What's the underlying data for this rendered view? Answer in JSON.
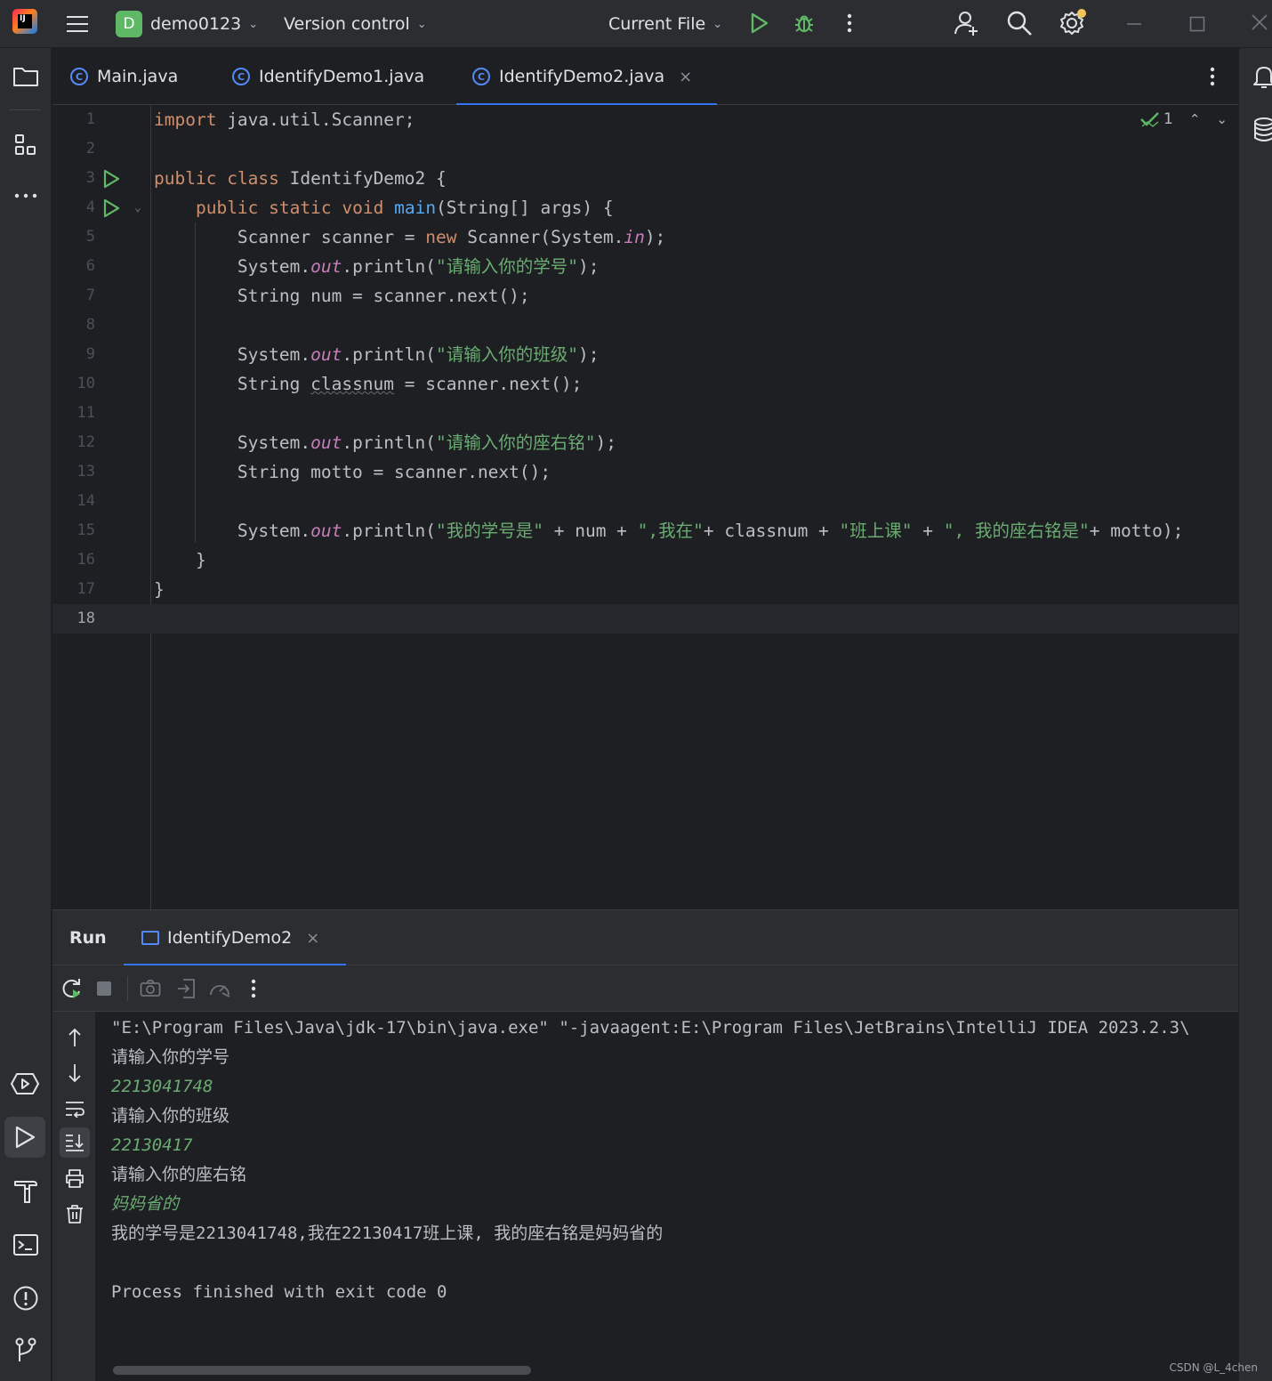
{
  "titlebar": {
    "app_logo": "IJ",
    "project_badge": "D",
    "project_name": "demo0123",
    "version_control": "Version control",
    "run_config": "Current File",
    "icons": [
      "hamburger-menu-icon",
      "chevron-down-icon",
      "run-icon",
      "debug-icon",
      "more-vertical-icon",
      "add-user-icon",
      "search-icon",
      "settings-icon",
      "minimize-icon",
      "maximize-icon",
      "close-icon"
    ]
  },
  "left_strip": {
    "icons": [
      "project-folder-icon",
      "structure-icon",
      "more-horizontal-icon",
      "services-icon",
      "run-tool-icon",
      "build-hammer-icon",
      "terminal-icon",
      "problems-icon",
      "git-icon"
    ]
  },
  "right_strip": {
    "icons": [
      "notifications-bell-icon",
      "database-icon"
    ]
  },
  "tabs": [
    {
      "label": "Main.java",
      "active": false
    },
    {
      "label": "IdentifyDemo1.java",
      "active": false
    },
    {
      "label": "IdentifyDemo2.java",
      "active": true
    }
  ],
  "tab_close": "×",
  "editor": {
    "inspection_count": "1",
    "current_line": 18,
    "lines": [
      {
        "n": "1",
        "tokens": [
          [
            "kw",
            "import"
          ],
          [
            "",
            " java.util.Scanner;"
          ]
        ]
      },
      {
        "n": "2",
        "tokens": []
      },
      {
        "n": "3",
        "run": true,
        "tokens": [
          [
            "kw",
            "public"
          ],
          [
            "",
            " "
          ],
          [
            "kw",
            "class"
          ],
          [
            "",
            " IdentifyDemo2 {"
          ]
        ]
      },
      {
        "n": "4",
        "run": true,
        "fold": true,
        "tokens": [
          [
            "",
            "    "
          ],
          [
            "kw",
            "public"
          ],
          [
            "",
            " "
          ],
          [
            "kw",
            "static"
          ],
          [
            "",
            " "
          ],
          [
            "kw",
            "void"
          ],
          [
            "",
            " "
          ],
          [
            "fn",
            "main"
          ],
          [
            "",
            "(String[] args) {"
          ]
        ]
      },
      {
        "n": "5",
        "tokens": [
          [
            "",
            "        Scanner scanner = "
          ],
          [
            "kw",
            "new"
          ],
          [
            "",
            " Scanner(System."
          ],
          [
            "st",
            "in"
          ],
          [
            "",
            ");"
          ]
        ]
      },
      {
        "n": "6",
        "tokens": [
          [
            "",
            "        System."
          ],
          [
            "st",
            "out"
          ],
          [
            "",
            ".println("
          ],
          [
            "str",
            "\"请输入你的学号\""
          ],
          [
            "",
            ");"
          ]
        ]
      },
      {
        "n": "7",
        "tokens": [
          [
            "",
            "        String num = scanner.next();"
          ]
        ]
      },
      {
        "n": "8",
        "tokens": []
      },
      {
        "n": "9",
        "tokens": [
          [
            "",
            "        System."
          ],
          [
            "st",
            "out"
          ],
          [
            "",
            ".println("
          ],
          [
            "str",
            "\"请输入你的班级\""
          ],
          [
            "",
            ");"
          ]
        ]
      },
      {
        "n": "10",
        "tokens": [
          [
            "",
            "        String "
          ],
          [
            "und",
            "classnum"
          ],
          [
            "",
            " = scanner.next();"
          ]
        ]
      },
      {
        "n": "11",
        "tokens": []
      },
      {
        "n": "12",
        "tokens": [
          [
            "",
            "        System."
          ],
          [
            "st",
            "out"
          ],
          [
            "",
            ".println("
          ],
          [
            "str",
            "\"请输入你的座右铭\""
          ],
          [
            "",
            ");"
          ]
        ]
      },
      {
        "n": "13",
        "tokens": [
          [
            "",
            "        String motto = scanner.next();"
          ]
        ]
      },
      {
        "n": "14",
        "tokens": []
      },
      {
        "n": "15",
        "tokens": [
          [
            "",
            "        System."
          ],
          [
            "st",
            "out"
          ],
          [
            "",
            ".println("
          ],
          [
            "str",
            "\"我的学号是\""
          ],
          [
            "",
            " + num + "
          ],
          [
            "str",
            "\",我在\""
          ],
          [
            "",
            "+ classnum + "
          ],
          [
            "str",
            "\"班上课\""
          ],
          [
            "",
            " + "
          ],
          [
            "str",
            "\", 我的座右铭是\""
          ],
          [
            "",
            "+ motto);"
          ]
        ]
      },
      {
        "n": "16",
        "tokens": [
          [
            "",
            "    }"
          ]
        ]
      },
      {
        "n": "17",
        "tokens": [
          [
            "",
            "}"
          ]
        ]
      },
      {
        "n": "18",
        "tokens": []
      }
    ]
  },
  "run_panel": {
    "title": "Run",
    "tab_label": "IdentifyDemo2",
    "toolbar_icons": [
      "rerun-icon",
      "stop-icon",
      "screenshot-icon",
      "exit-icon",
      "profiler-icon",
      "more-vertical-icon"
    ],
    "gutter_icons": [
      "scroll-up-icon",
      "scroll-down-icon",
      "soft-wrap-icon",
      "scroll-to-end-icon",
      "print-icon",
      "clear-trash-icon"
    ],
    "console": [
      {
        "text": "\"E:\\Program Files\\Java\\jdk-17\\bin\\java.exe\" \"-javaagent:E:\\Program Files\\JetBrains\\IntelliJ IDEA 2023.2.3\\",
        "input": false
      },
      {
        "text": "请输入你的学号",
        "input": false
      },
      {
        "text": "2213041748",
        "input": true
      },
      {
        "text": "请输入你的班级",
        "input": false
      },
      {
        "text": "22130417",
        "input": true
      },
      {
        "text": "请输入你的座右铭",
        "input": false
      },
      {
        "text": "妈妈省的",
        "input": true
      },
      {
        "text": "我的学号是2213041748,我在22130417班上课, 我的座右铭是妈妈省的",
        "input": false
      },
      {
        "text": "",
        "input": false
      },
      {
        "text": "Process finished with exit code 0",
        "input": false
      }
    ]
  },
  "watermark": "CSDN @L_4chen",
  "colors": {
    "accent": "#3574f0",
    "keyword": "#cf8e6d",
    "string": "#6aab73",
    "function": "#56a8f5",
    "static_field": "#c77dbb",
    "run_green": "#5fb865"
  }
}
